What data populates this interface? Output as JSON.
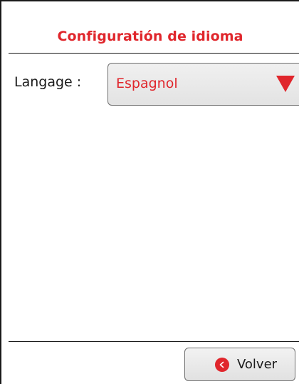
{
  "header": {
    "title": "Configuratión de idioma"
  },
  "language": {
    "label": "Langage :",
    "selected": "Espagnol",
    "arrow_icon": "triangle-down-icon"
  },
  "footer": {
    "back_label": "Volver",
    "back_icon": "chevron-left-icon"
  },
  "colors": {
    "accent": "#e0262c",
    "text": "#1a1a1a",
    "button_bg": "#e8e8e8",
    "border": "#6f6f6f"
  }
}
